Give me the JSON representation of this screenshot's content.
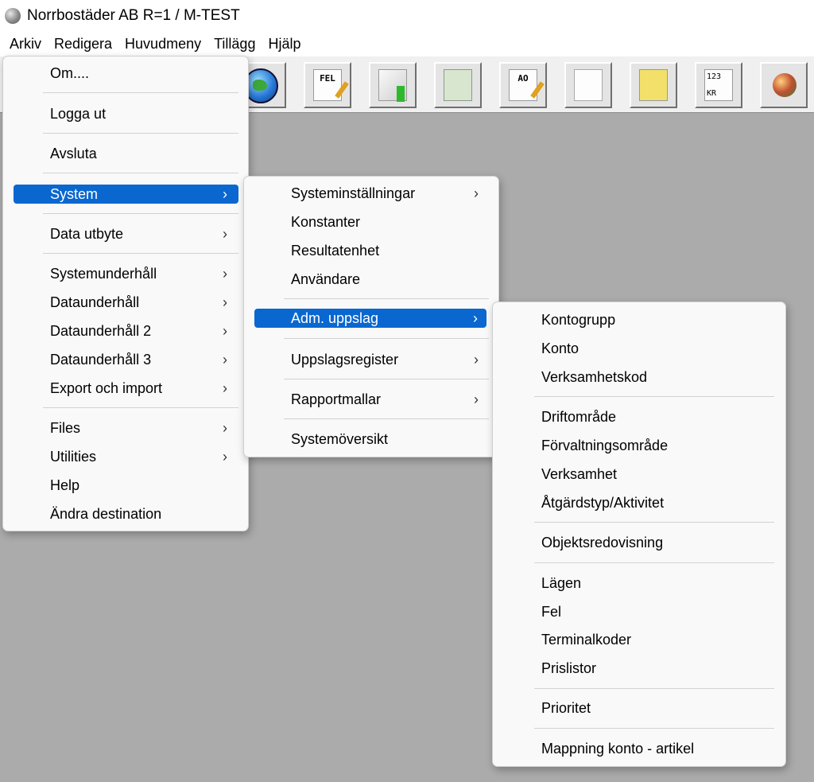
{
  "window": {
    "title": "Norrbostäder AB R=1 / M-TEST",
    "icon": "app-globe-icon"
  },
  "menubar": [
    "Arkiv",
    "Redigera",
    "Huvudmeny",
    "Tillägg",
    "Hjälp"
  ],
  "toolbar": {
    "buttons": [
      {
        "icon": "globe-icon"
      },
      {
        "icon": "fel-document-icon",
        "text": "FEL"
      },
      {
        "icon": "mail-download-icon"
      },
      {
        "icon": "people-search-icon"
      },
      {
        "icon": "ao-document-icon",
        "text": "AO"
      },
      {
        "icon": "document-people-icon"
      },
      {
        "icon": "screen-globe-icon"
      },
      {
        "icon": "kr-document-icon",
        "text_top": "123",
        "text_bottom": "KR"
      },
      {
        "icon": "sphere-icon"
      }
    ]
  },
  "menu_arkiv": [
    "Om....",
    "Logga ut",
    "Avsluta",
    "System",
    "Data utbyte",
    "Systemunderhåll",
    "Dataunderhåll",
    "Dataunderhåll 2",
    "Dataunderhåll 3",
    "Export och import",
    "Files",
    "Utilities",
    "Help",
    "Ändra destination"
  ],
  "menu_system": [
    "Systeminställningar",
    "Konstanter",
    "Resultatenhet",
    "Användare",
    "Adm. uppslag",
    "Uppslagsregister",
    "Rapportmallar",
    "Systemöversikt"
  ],
  "menu_adm": [
    "Kontogrupp",
    "Konto",
    "Verksamhetskod",
    "Driftområde",
    "Förvaltningsområde",
    "Verksamhet",
    "Åtgärdstyp/Aktivitet",
    "Objektsredovisning",
    "Lägen",
    "Fel",
    "Terminalkoder",
    "Prislistor",
    "Prioritet",
    "Mappning konto - artikel"
  ],
  "colors": {
    "highlight": "#0a67d0",
    "workspace": "#ababab",
    "menu_bg": "#f9f9f9"
  }
}
